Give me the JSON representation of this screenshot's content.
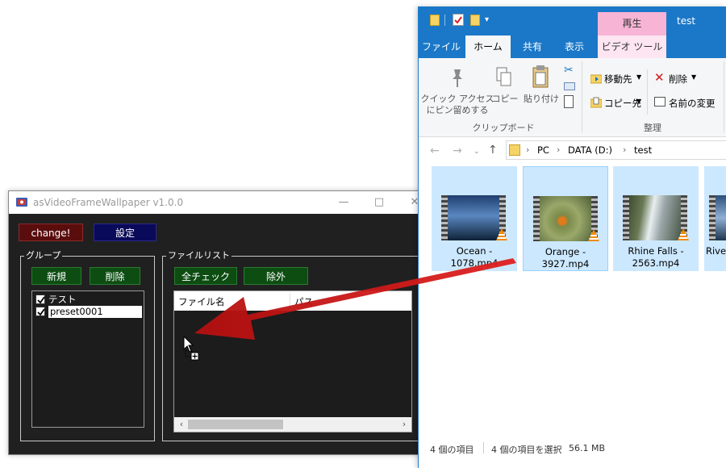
{
  "app": {
    "title": "asVideoFrameWallpaper v1.0.0",
    "change_button": "change!",
    "settings_button": "設定",
    "group_legend": "グループ",
    "new_button": "新規",
    "delete_button": "削除",
    "groups": [
      {
        "label": "テスト",
        "checked": true
      },
      {
        "label": "preset0001",
        "checked": true
      }
    ],
    "filelist_legend": "ファイルリスト",
    "check_all_button": "全チェック",
    "exclude_button": "除外",
    "columns": [
      "ファイル名",
      "パス"
    ]
  },
  "explorer": {
    "contextual_tab": "再生",
    "window_title": "test",
    "tabs": [
      "ファイル",
      "ホーム",
      "共有",
      "表示",
      "ビデオ ツール"
    ],
    "ribbon": {
      "pin_label_line1": "クイック アクセス",
      "pin_label_line2": "にピン留めする",
      "copy_label": "コピー",
      "paste_label": "貼り付け",
      "clipboard_group": "クリップボード",
      "move_to": "移動先",
      "copy_to": "コピー先",
      "delete": "削除",
      "rename": "名前の変更",
      "organize_group": "整理"
    },
    "breadcrumb": [
      "PC",
      "DATA (D:)",
      "test"
    ],
    "files": [
      {
        "line1": "Ocean -",
        "line2": "1078.mp4"
      },
      {
        "line1": "Orange -",
        "line2": "3927.mp4"
      },
      {
        "line1": "Rhine Falls -",
        "line2": "2563.mp4"
      },
      {
        "line1": "Rive",
        "line2": ""
      }
    ],
    "status_items": "4 個の項目",
    "status_selected": "4 個の項目を選択",
    "status_size": "56.1 MB"
  },
  "colors": {
    "app_bg": "#202020",
    "change_btn_bg": "#5a0d0d",
    "settings_btn_bg": "#0a0a5a",
    "green_btn_bg": "#0d4d12",
    "explorer_accent": "#1b78c8",
    "contextual_tab": "#f7b4d5",
    "selection": "#cce8ff",
    "arrow": "#cc1111"
  }
}
